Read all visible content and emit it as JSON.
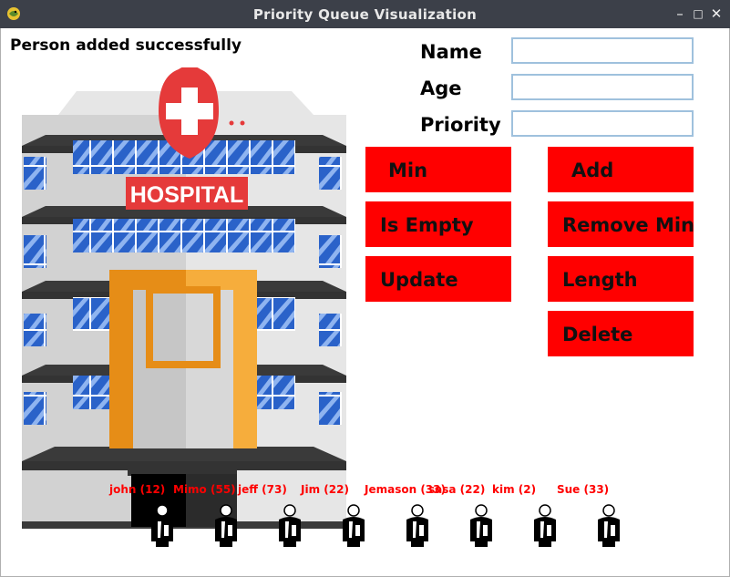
{
  "window": {
    "title": "Priority Queue Visualization",
    "minimize_glyph": "–",
    "maximize_glyph": "□",
    "close_glyph": "✕"
  },
  "status": "Person added successfully",
  "form": {
    "name_label": "Name",
    "age_label": "Age",
    "priority_label": "Priority",
    "name_value": "",
    "age_value": "",
    "priority_value": ""
  },
  "buttons": {
    "min": "Min",
    "add": "Add",
    "is_empty": "Is Empty",
    "remove_min": "Remove Min",
    "update": "Update",
    "length": "Length",
    "delete": "Delete"
  },
  "hospital": {
    "sign": "HOSPITAL",
    "icon": "hospital-building-icon"
  },
  "queue": [
    {
      "label": "john (12)"
    },
    {
      "label": "Mimo (55)"
    },
    {
      "label": "jeff (73)"
    },
    {
      "label": "Jim (22)"
    },
    {
      "label": "Jemason (33)"
    },
    {
      "label": "sasa (22)"
    },
    {
      "label": "kim (2)"
    },
    {
      "label": "Sue (33)"
    }
  ],
  "colors": {
    "button": "#ff0000",
    "queue_label": "#ff0000",
    "titlebar": "#3c4049",
    "input_border": "#9fc1dd"
  }
}
